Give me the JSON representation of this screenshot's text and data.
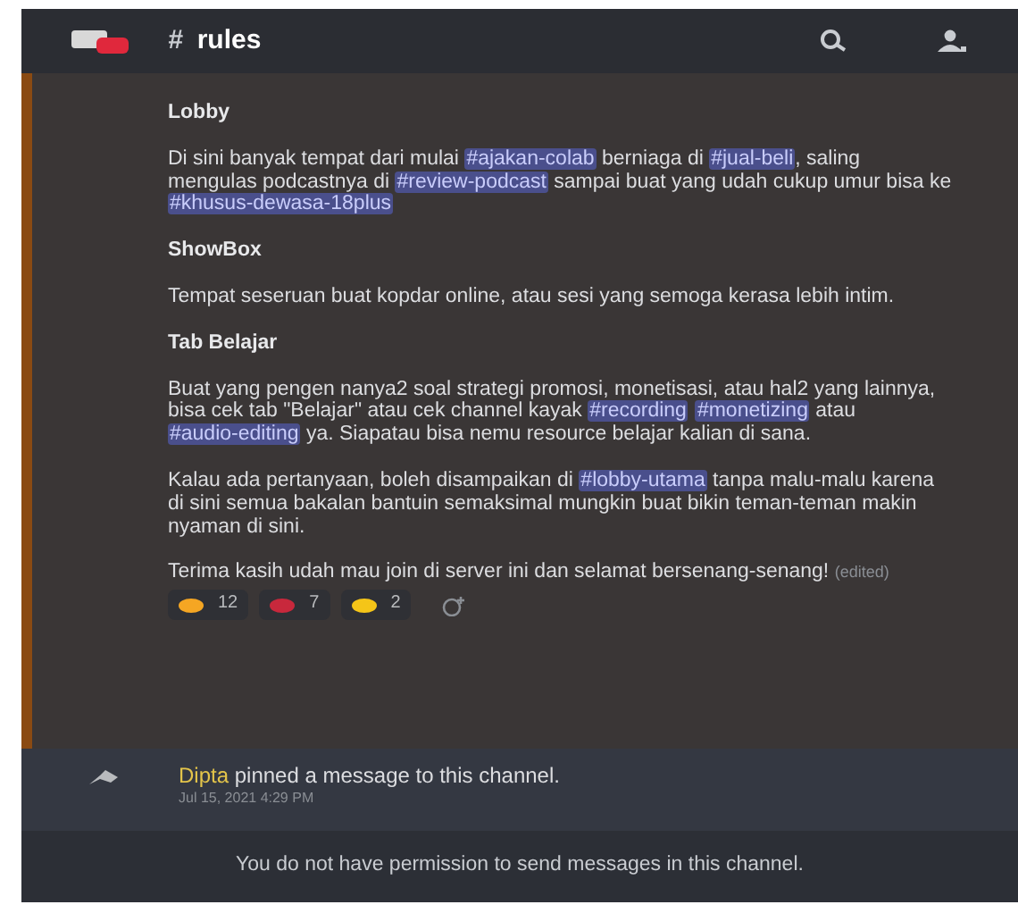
{
  "header": {
    "hash": "#",
    "title": "rules"
  },
  "message": {
    "blocks": [
      {
        "kind": "heading",
        "text": "Lobby"
      },
      {
        "kind": "paragraph",
        "parts": [
          {
            "kind": "text",
            "text": "Di sini banyak tempat dari mulai "
          },
          {
            "kind": "mention",
            "text": "#ajakan-colab"
          },
          {
            "kind": "text",
            "text": " berniaga di "
          },
          {
            "kind": "mention",
            "text": "#jual-beli"
          },
          {
            "kind": "text",
            "text": ", saling mengulas podcastnya di "
          },
          {
            "kind": "mention",
            "text": "#review-podcast"
          },
          {
            "kind": "text",
            "text": " sampai buat yang udah cukup umur bisa ke "
          },
          {
            "kind": "mention",
            "text": "#khusus-dewasa-18plus"
          }
        ]
      },
      {
        "kind": "heading",
        "text": "ShowBox"
      },
      {
        "kind": "paragraph",
        "parts": [
          {
            "kind": "text",
            "text": "Tempat seseruan buat kopdar online, atau sesi yang semoga kerasa lebih intim."
          }
        ]
      },
      {
        "kind": "heading",
        "text": "Tab Belajar"
      },
      {
        "kind": "paragraph",
        "parts": [
          {
            "kind": "text",
            "text": "Buat yang pengen nanya2 soal strategi promosi, monetisasi, atau hal2 yang lainnya, bisa cek tab \"Belajar\" atau cek channel kayak "
          },
          {
            "kind": "mention",
            "text": "#recording"
          },
          {
            "kind": "mention",
            "text": "#monetizing"
          },
          {
            "kind": "text",
            "text": " atau "
          },
          {
            "kind": "mention",
            "text": "#audio-editing"
          },
          {
            "kind": "text",
            "text": " ya. Siapatau bisa nemu resource belajar kalian di sana."
          }
        ]
      },
      {
        "kind": "paragraph",
        "parts": [
          {
            "kind": "text",
            "text": "Kalau ada pertanyaan, boleh disampaikan di "
          },
          {
            "kind": "mention",
            "text": "#lobby-utama"
          },
          {
            "kind": "text",
            "text": " tanpa malu-malu karena di sini semua bakalan bantuin semaksimal mungkin buat bikin teman-teman makin nyaman di sini."
          }
        ]
      },
      {
        "kind": "paragraph",
        "parts": [
          {
            "kind": "text",
            "text": "Terima kasih udah mau join di server ini dan selamat bersenang-senang! "
          },
          {
            "kind": "edited",
            "text": "(edited)"
          }
        ]
      }
    ],
    "reactions": [
      {
        "color": "#f5a623",
        "count": "12"
      },
      {
        "color": "#c8283c",
        "count": "7"
      },
      {
        "color": "#f5c518",
        "count": "2"
      }
    ]
  },
  "pin_notice": {
    "user": "Dipta",
    "text": " pinned a message to this channel.",
    "timestamp": "Jul 15, 2021 4:29 PM"
  },
  "composer": {
    "notice": "You do not have permission to send messages in this channel."
  }
}
